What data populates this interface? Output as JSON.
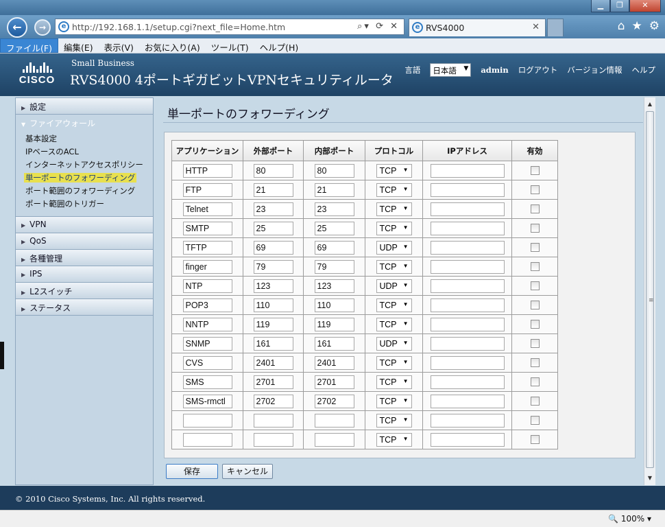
{
  "browser": {
    "address": "http://192.168.1.1/setup.cgi?next_file=Home.htm",
    "tab_title": "RVS4000",
    "zoom": "100%"
  },
  "menubar": [
    "ファイル(F)",
    "編集(E)",
    "表示(V)",
    "お気に入り(A)",
    "ツール(T)",
    "ヘルプ(H)"
  ],
  "header": {
    "brand": "CISCO",
    "small_business": "Small Business",
    "product_title": "RVS4000 4ポートギガビットVPNセキュリティルータ",
    "language_label": "言語",
    "language_value": "日本語",
    "user": "admin",
    "logout": "ログアウト",
    "version_info": "バージョン情報",
    "help": "ヘルプ"
  },
  "sidebar": {
    "groups": [
      {
        "label": "設定",
        "open": false
      },
      {
        "label": "ファイアウォール",
        "open": true
      },
      {
        "label": "VPN",
        "open": false
      },
      {
        "label": "QoS",
        "open": false
      },
      {
        "label": "各種管理",
        "open": false
      },
      {
        "label": "IPS",
        "open": false
      },
      {
        "label": "L2スイッチ",
        "open": false
      },
      {
        "label": "ステータス",
        "open": false
      }
    ],
    "firewall_items": [
      "基本設定",
      "IPベースのACL",
      "インターネットアクセスポリシー",
      "単一ポートのフォワーディング",
      "ポート範囲のフォワーディング",
      "ポート範囲のトリガー"
    ],
    "active_item": "単一ポートのフォワーディング"
  },
  "content": {
    "title": "単一ポートのフォワーディング",
    "columns": [
      "アプリケーション",
      "外部ポート",
      "内部ポート",
      "プロトコル",
      "IPアドレス",
      "有効"
    ],
    "rows": [
      {
        "app": "HTTP",
        "ext": "80",
        "int": "80",
        "proto": "TCP",
        "ip": "",
        "enabled": false
      },
      {
        "app": "FTP",
        "ext": "21",
        "int": "21",
        "proto": "TCP",
        "ip": "",
        "enabled": false
      },
      {
        "app": "Telnet",
        "ext": "23",
        "int": "23",
        "proto": "TCP",
        "ip": "",
        "enabled": false
      },
      {
        "app": "SMTP",
        "ext": "25",
        "int": "25",
        "proto": "TCP",
        "ip": "",
        "enabled": false
      },
      {
        "app": "TFTP",
        "ext": "69",
        "int": "69",
        "proto": "UDP",
        "ip": "",
        "enabled": false
      },
      {
        "app": "finger",
        "ext": "79",
        "int": "79",
        "proto": "TCP",
        "ip": "",
        "enabled": false
      },
      {
        "app": "NTP",
        "ext": "123",
        "int": "123",
        "proto": "UDP",
        "ip": "",
        "enabled": false
      },
      {
        "app": "POP3",
        "ext": "110",
        "int": "110",
        "proto": "TCP",
        "ip": "",
        "enabled": false
      },
      {
        "app": "NNTP",
        "ext": "119",
        "int": "119",
        "proto": "TCP",
        "ip": "",
        "enabled": false
      },
      {
        "app": "SNMP",
        "ext": "161",
        "int": "161",
        "proto": "UDP",
        "ip": "",
        "enabled": false
      },
      {
        "app": "CVS",
        "ext": "2401",
        "int": "2401",
        "proto": "TCP",
        "ip": "",
        "enabled": false
      },
      {
        "app": "SMS",
        "ext": "2701",
        "int": "2701",
        "proto": "TCP",
        "ip": "",
        "enabled": false
      },
      {
        "app": "SMS-rmctl",
        "ext": "2702",
        "int": "2702",
        "proto": "TCP",
        "ip": "",
        "enabled": false
      },
      {
        "app": "",
        "ext": "",
        "int": "",
        "proto": "TCP",
        "ip": "",
        "enabled": false
      },
      {
        "app": "",
        "ext": "",
        "int": "",
        "proto": "TCP",
        "ip": "",
        "enabled": false
      }
    ],
    "save_label": "保存",
    "cancel_label": "キャンセル"
  },
  "footer": "© 2010 Cisco Systems, Inc. All rights reserved."
}
